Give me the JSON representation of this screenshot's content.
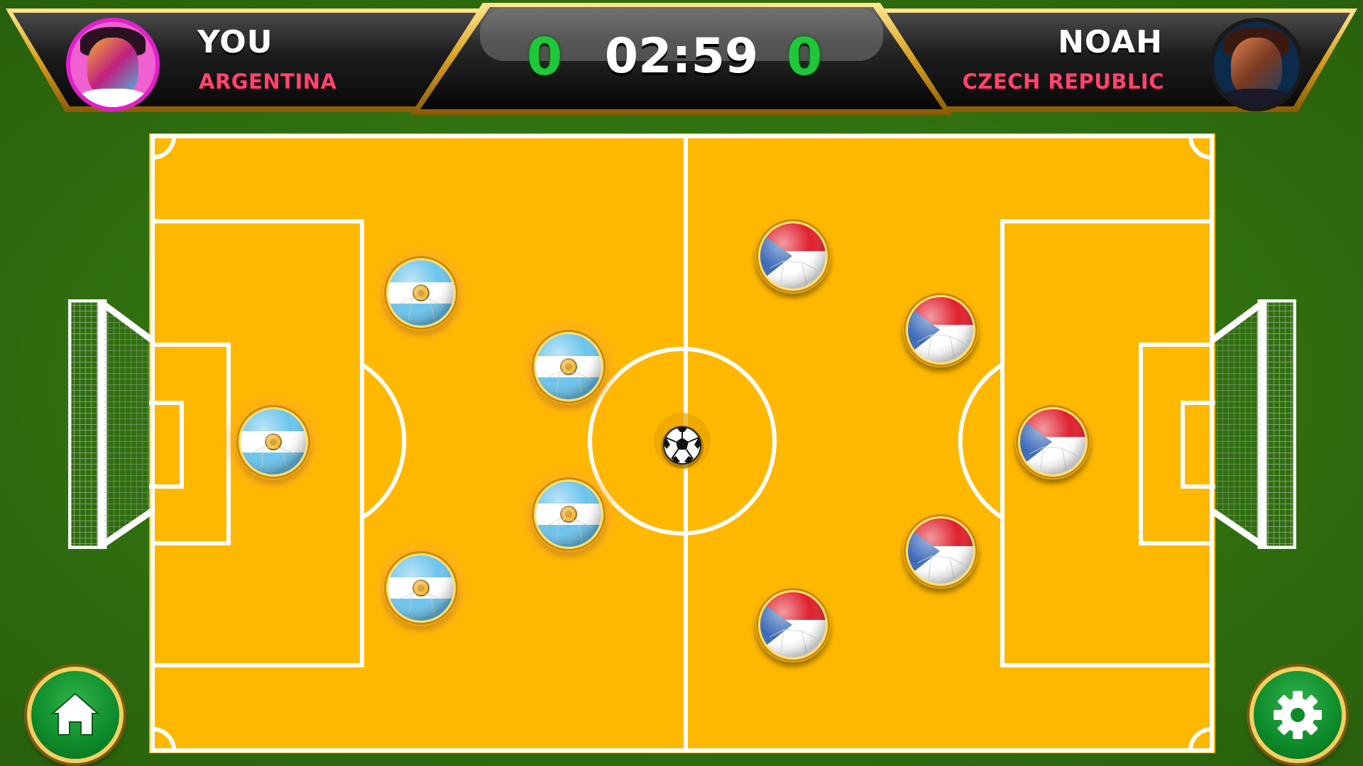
{
  "player_left": {
    "name": "YOU",
    "team": "ARGENTINA",
    "score": "0",
    "avatar_icon": "player-avatar-icon",
    "color": "#ff4470"
  },
  "player_right": {
    "name": "NOAH",
    "team": "CZECH REPUBLIC",
    "score": "0",
    "avatar_icon": "player-avatar-icon",
    "color": "#ff4470"
  },
  "timer": "02:59",
  "colors": {
    "pitch": "#ffb800",
    "grass": "#2f6f10",
    "score": "#1ec83a",
    "button": "#0d8a2a"
  },
  "controls": {
    "home_icon": "home-icon",
    "settings_icon": "gear-icon"
  },
  "pieces": {
    "left_team_count": 5,
    "right_team_count": 5,
    "left_flag": "argentina-flag-icon",
    "right_flag": "czech-flag-icon"
  }
}
